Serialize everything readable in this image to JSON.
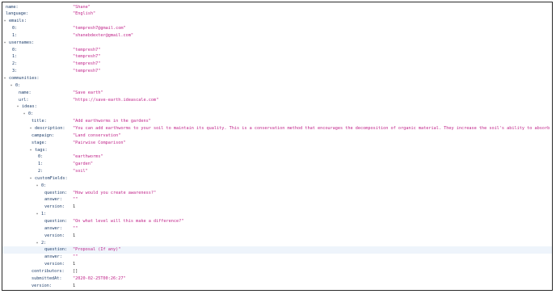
{
  "rows": [
    {
      "depth": 0,
      "key": "name:",
      "value": "\"Shane\"",
      "kind": "string"
    },
    {
      "depth": 0,
      "key": "language:",
      "value": "\"English\"",
      "kind": "string"
    },
    {
      "depth": 0,
      "key": "emails:",
      "toggle": "open"
    },
    {
      "depth": 1,
      "key": "0:",
      "value": "\"tempresh7@gmail.com\"",
      "kind": "string"
    },
    {
      "depth": 1,
      "key": "1:",
      "value": "\"shanebdexter@gmail.com\"",
      "kind": "string"
    },
    {
      "depth": 0,
      "key": "usernames:",
      "toggle": "open"
    },
    {
      "depth": 1,
      "key": "0:",
      "value": "\"tempresh7\"",
      "kind": "string"
    },
    {
      "depth": 1,
      "key": "1:",
      "value": "\"tempresh7\"",
      "kind": "string"
    },
    {
      "depth": 1,
      "key": "2:",
      "value": "\"tempresh7\"",
      "kind": "string"
    },
    {
      "depth": 1,
      "key": "3:",
      "value": "\"tempresh7\"",
      "kind": "string"
    },
    {
      "depth": 0,
      "key": "communities:",
      "toggle": "open"
    },
    {
      "depth": 1,
      "key": "0:",
      "toggle": "open"
    },
    {
      "depth": 2,
      "key": "name:",
      "value": "\"Save earth\"",
      "kind": "string"
    },
    {
      "depth": 2,
      "key": "url:",
      "value": "\"https://save-earth.ideascale.com\"",
      "kind": "string"
    },
    {
      "depth": 2,
      "key": "ideas:",
      "toggle": "open"
    },
    {
      "depth": 3,
      "key": "0:",
      "toggle": "open"
    },
    {
      "depth": 4,
      "key": "title:",
      "value": "\"Add earthworms in the gardens\"",
      "kind": "string"
    },
    {
      "depth": 4,
      "key": "description:",
      "toggle": "open",
      "value": "\"You can add earthworms to your soil to maintain its quality. This is a conservation method that encourages the decomposition of organic material. They increase the soil's ability to absorb nutrients.\"",
      "kind": "string"
    },
    {
      "depth": 4,
      "key": "campaign:",
      "value": "\"Land conservation\"",
      "kind": "string"
    },
    {
      "depth": 4,
      "key": "stage:",
      "value": "\"Pairwise Comparison\"",
      "kind": "string"
    },
    {
      "depth": 4,
      "key": "tags:",
      "toggle": "open"
    },
    {
      "depth": 5,
      "key": "0:",
      "value": "\"earthworms\"",
      "kind": "string"
    },
    {
      "depth": 5,
      "key": "1:",
      "value": "\"garden\"",
      "kind": "string"
    },
    {
      "depth": 5,
      "key": "2:",
      "value": "\"soil\"",
      "kind": "string"
    },
    {
      "depth": 4,
      "key": "customFields:",
      "toggle": "open"
    },
    {
      "depth": 5,
      "key": "0:",
      "toggle": "open"
    },
    {
      "depth": 6,
      "key": "question:",
      "value": "\"How would you create awareness?\"",
      "kind": "string"
    },
    {
      "depth": 6,
      "key": "answer:",
      "value": "\"\"",
      "kind": "string"
    },
    {
      "depth": 6,
      "key": "version:",
      "value": "1",
      "kind": "number"
    },
    {
      "depth": 5,
      "key": "1:",
      "toggle": "open"
    },
    {
      "depth": 6,
      "key": "question:",
      "value": "\"On what level will this make a difference?\"",
      "kind": "string"
    },
    {
      "depth": 6,
      "key": "answer:",
      "value": "\"\"",
      "kind": "string"
    },
    {
      "depth": 6,
      "key": "version:",
      "value": "1",
      "kind": "number"
    },
    {
      "depth": 5,
      "key": "2:",
      "toggle": "open"
    },
    {
      "depth": 6,
      "key": "question:",
      "value": "\"Proposal (If any)\"",
      "kind": "string",
      "highlight": true
    },
    {
      "depth": 6,
      "key": "answer:",
      "value": "\"\"",
      "kind": "string"
    },
    {
      "depth": 6,
      "key": "version:",
      "value": "1",
      "kind": "number"
    },
    {
      "depth": 4,
      "key": "contributors:",
      "value": "[]",
      "kind": "empty"
    },
    {
      "depth": 4,
      "key": "submittedAt:",
      "value": "\"2020-02-25T00:26:27\"",
      "kind": "string"
    },
    {
      "depth": 4,
      "key": "version:",
      "value": "1",
      "kind": "number"
    }
  ],
  "toggle_glyph": "▾",
  "colors": {
    "key": "#1f3f6b",
    "string": "#c0248a",
    "plain": "#333333",
    "highlight": "#eef4fb"
  }
}
